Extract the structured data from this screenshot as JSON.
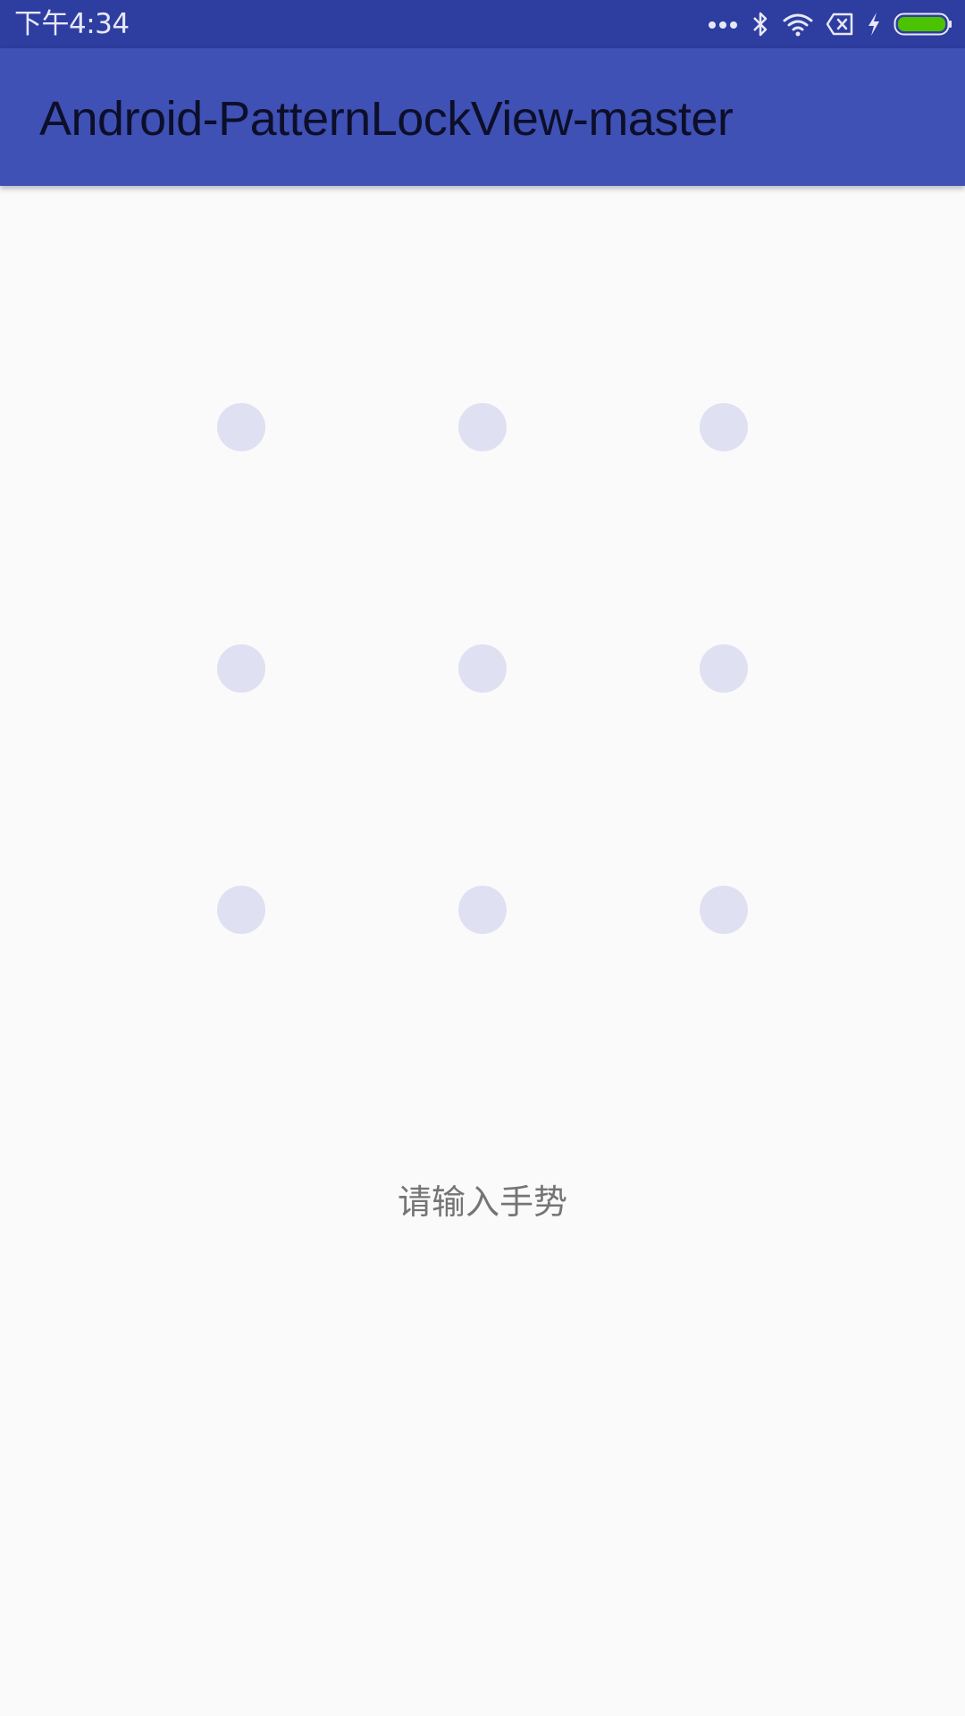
{
  "status_bar": {
    "time": "下午4:34",
    "icons": [
      "more-dots-icon",
      "bluetooth-icon",
      "wifi-icon",
      "no-sim-icon",
      "charging-icon",
      "battery-icon"
    ],
    "background": "#2e3da0"
  },
  "app_bar": {
    "title": "Android-PatternLockView-master",
    "background": "#3f51b5"
  },
  "pattern_lock": {
    "rows": 3,
    "columns": 3,
    "dot_color": "#e0e0f3",
    "selected": []
  },
  "hint": {
    "text": "请输入手势",
    "color": "#757575"
  },
  "colors": {
    "background": "#fafafa",
    "battery": "#4cc300"
  }
}
